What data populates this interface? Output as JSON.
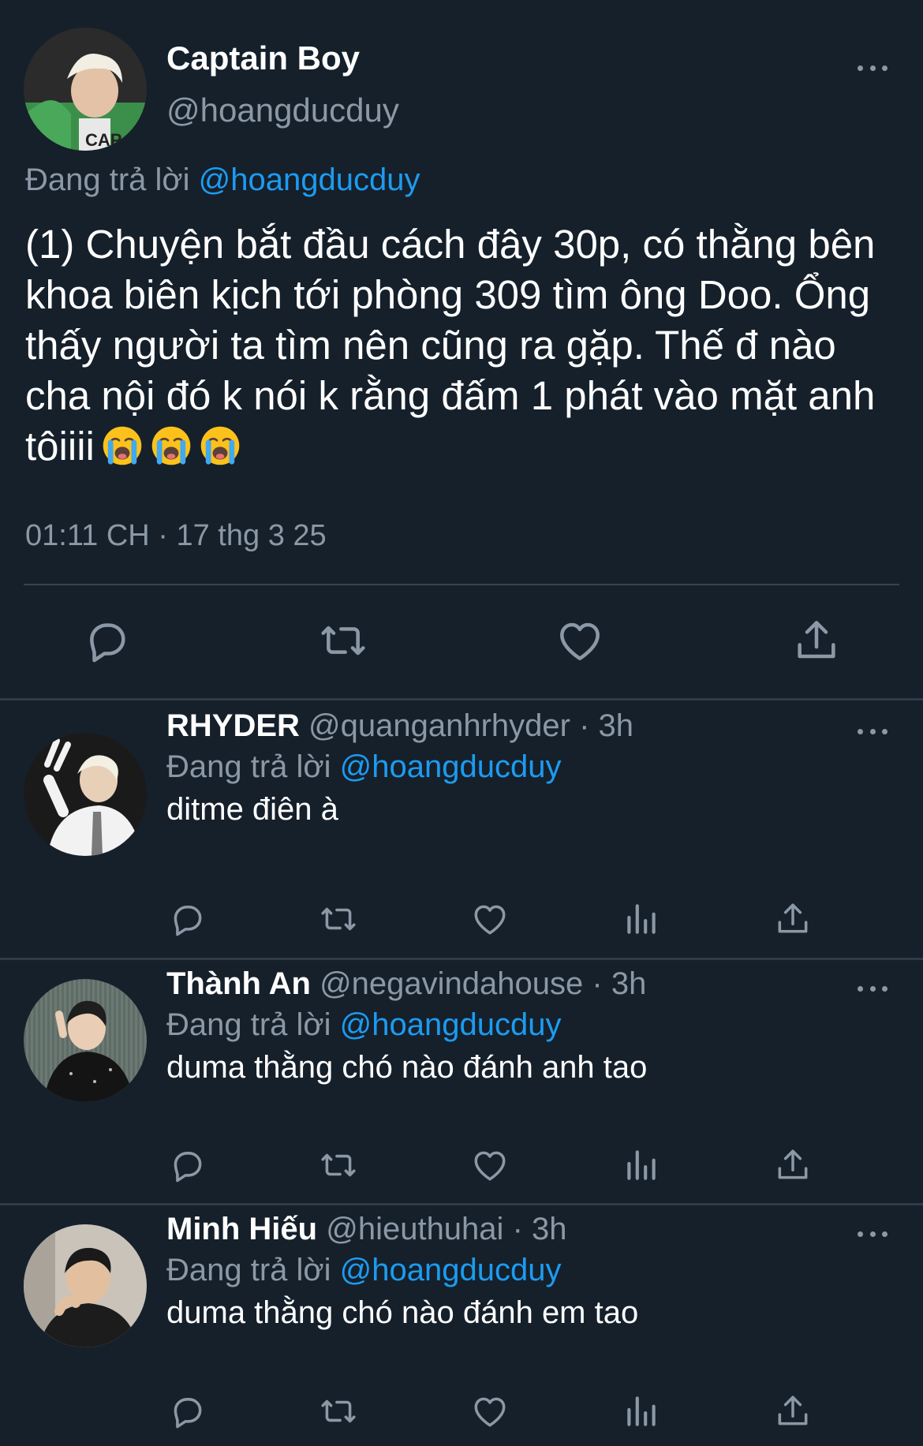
{
  "main_tweet": {
    "name": "Captain Boy",
    "handle": "@hoangducduy",
    "replying_prefix": "Đang trả lời",
    "replying_to": "@hoangducduy",
    "text": "(1) Chuyện bắt đầu cách đây 30p, có thằng bên khoa biên kịch tới phòng 309 tìm ông Doo. Ổng thấy người ta tìm nên cũng ra gặp. Thế đ nào cha nội đó k nói k rằng đấm 1 phát vào mặt anh tôiiii",
    "emojis": [
      "loudly-crying-face",
      "loudly-crying-face",
      "loudly-crying-face"
    ],
    "timestamp": "01:11 CH · 17 thg 3 25",
    "actions": [
      "reply-icon",
      "retweet-icon",
      "like-icon",
      "share-icon"
    ]
  },
  "replies": [
    {
      "name": "RHYDER",
      "handle": "@quanganhrhyder",
      "time": "· 3h",
      "replying_prefix": "Đang trả lời",
      "replying_to": "@hoangducduy",
      "text": "ditme điên à"
    },
    {
      "name": "Thành An",
      "handle": "@negavindahouse",
      "time": "· 3h",
      "replying_prefix": "Đang trả lời",
      "replying_to": "@hoangducduy",
      "text": "duma thằng chó nào đánh anh tao"
    },
    {
      "name": "Minh Hiếu",
      "handle": "@hieuthuhai",
      "time": "· 3h",
      "replying_prefix": "Đang trả lời",
      "replying_to": "@hoangducduy",
      "text": "duma thằng chó nào đánh em tao"
    }
  ],
  "colors": {
    "background": "#15202b",
    "text": "#ffffff",
    "secondary": "#8b98a5",
    "link": "#1d9bf0",
    "divider": "#38444d"
  }
}
